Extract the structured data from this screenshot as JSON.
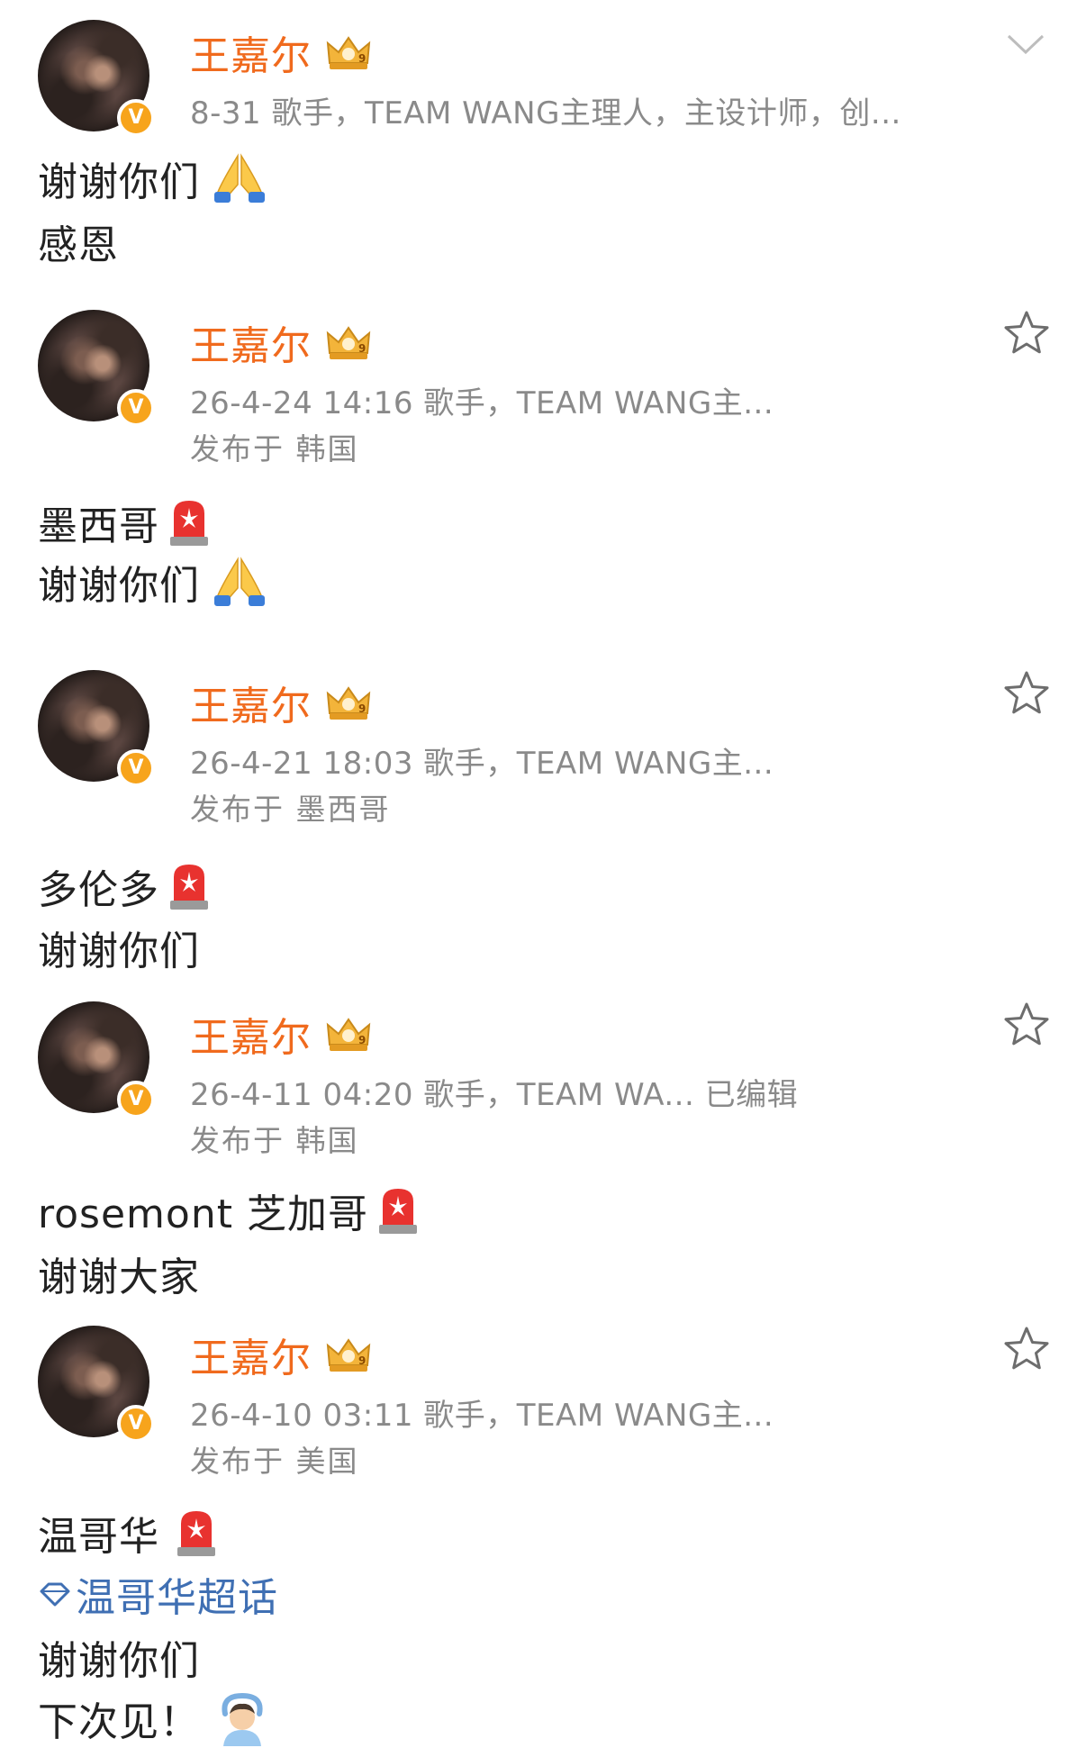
{
  "colors": {
    "name": "#f06a1d",
    "meta": "#8a8a8a",
    "body_text": "#222222",
    "topic_link": "#3f6fb3",
    "verified_badge": "#f7a41c"
  },
  "posts": [
    {
      "author": "王嘉尔",
      "verified_badge": "V",
      "meta": "8-31  歌手，TEAM WANG主理人，主设计师，创...",
      "lines": [
        "谢谢你们",
        "感恩"
      ]
    },
    {
      "author": "王嘉尔",
      "verified_badge": "V",
      "meta": "26-4-24 14:16  歌手，TEAM WANG主...",
      "location": "发布于 韩国",
      "lines": [
        "墨西哥",
        "谢谢你们"
      ]
    },
    {
      "author": "王嘉尔",
      "verified_badge": "V",
      "meta": "26-4-21 18:03  歌手，TEAM WANG主...",
      "location": "发布于 墨西哥",
      "lines": [
        "多伦多",
        "谢谢你们"
      ]
    },
    {
      "author": "王嘉尔",
      "verified_badge": "V",
      "meta": "26-4-11 04:20  歌手，TEAM WA...  已编辑",
      "location": "发布于 韩国",
      "lines": [
        "rosemont 芝加哥",
        "谢谢大家"
      ]
    },
    {
      "author": "王嘉尔",
      "verified_badge": "V",
      "meta": "26-4-10 03:11  歌手，TEAM WANG主...",
      "location": "发布于 美国",
      "lines": [
        "温哥华",
        "温哥华超话",
        "谢谢你们",
        "下次见！"
      ]
    }
  ],
  "icons": {
    "header_action": "chevron-down-icon",
    "favorite": "star-outline-icon",
    "crown": "crown-badge-icon",
    "topic": "diamond-topic-icon",
    "emojis": [
      "folded-hands-emoji",
      "police-siren-emoji",
      "person-gesturing-ok-emoji"
    ]
  }
}
